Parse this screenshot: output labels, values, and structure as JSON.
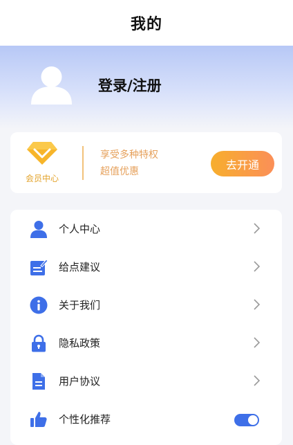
{
  "header": {
    "title": "我的"
  },
  "profile": {
    "login_label": "登录/注册"
  },
  "vip": {
    "label": "会员中心",
    "perk_line1": "享受多种特权",
    "perk_line2": "超值优惠",
    "button_label": "去开通"
  },
  "menu": {
    "items": [
      {
        "label": "个人中心",
        "icon": "person-icon"
      },
      {
        "label": "给点建议",
        "icon": "feedback-icon"
      },
      {
        "label": "关于我们",
        "icon": "info-icon"
      },
      {
        "label": "隐私政策",
        "icon": "lock-icon"
      },
      {
        "label": "用户协议",
        "icon": "document-icon"
      },
      {
        "label": "个性化推荐",
        "icon": "thumbs-up-icon",
        "toggle_on": true
      }
    ]
  },
  "colors": {
    "accent": "#3e6fe8",
    "vip_orange": "#f7ae2d",
    "vip_text": "#e6a15c"
  }
}
